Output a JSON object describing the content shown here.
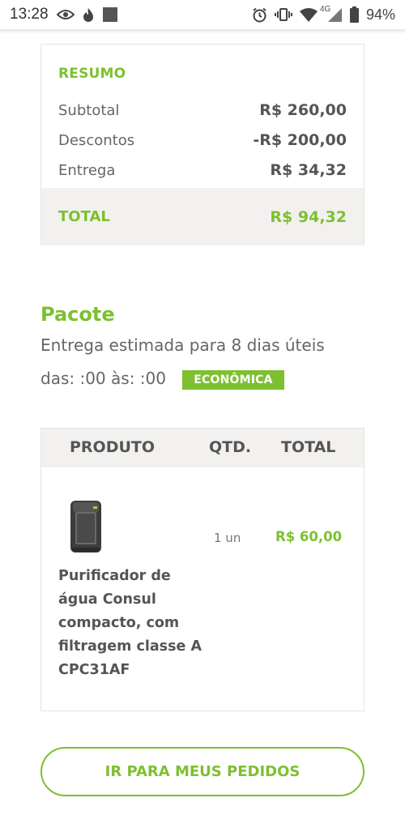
{
  "status_bar": {
    "time": "13:28",
    "network_label": "4G",
    "battery_percent": "94%",
    "icons": [
      "eye-icon",
      "fire-icon",
      "square-icon",
      "alarm-icon",
      "vibrate-icon",
      "wifi-icon",
      "signal-icon",
      "battery-icon"
    ]
  },
  "summary": {
    "title": "RESUMO",
    "rows": [
      {
        "label": "Subtotal",
        "value": "R$ 260,00"
      },
      {
        "label": "Descontos",
        "value": "-R$ 200,00"
      },
      {
        "label": "Entrega",
        "value": "R$ 34,32"
      }
    ],
    "total_label": "TOTAL",
    "total_value": "R$ 94,32"
  },
  "package": {
    "title": "Pacote",
    "estimate": "Entrega estimada para 8 dias úteis",
    "window": "das: :00 às: :00",
    "badge": "ECONÔMICA"
  },
  "product_table": {
    "headers": {
      "product": "PRODUTO",
      "qty": "QTD.",
      "total": "TOTAL"
    },
    "items": [
      {
        "name": "Purificador de água Consul compacto, com filtragem classe A CPC31AF",
        "qty": "1 un",
        "price": "R$ 60,00",
        "image_icon": "water-purifier-image"
      }
    ]
  },
  "actions": {
    "orders_button": "IR PARA MEUS PEDIDOS"
  },
  "colors": {
    "accent": "#7dc030",
    "band": "#f2f1ef",
    "text": "#555555"
  }
}
